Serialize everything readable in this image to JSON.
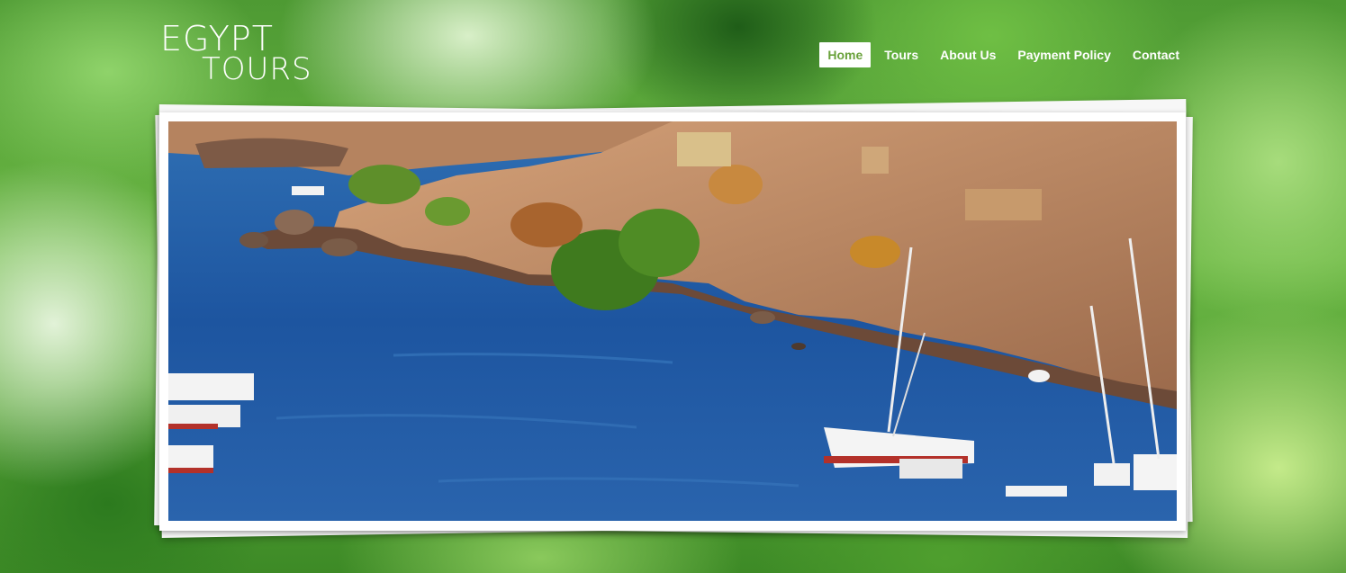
{
  "logo": {
    "line1": "EGYPT",
    "line2": "TOURS"
  },
  "nav": {
    "items": [
      {
        "label": "Home",
        "active": true
      },
      {
        "label": "Tours",
        "active": false
      },
      {
        "label": "About Us",
        "active": false
      },
      {
        "label": "Payment Policy",
        "active": false
      },
      {
        "label": "Contact",
        "active": false
      }
    ]
  },
  "colors": {
    "accent": "#6aa23c",
    "nav_text": "#ffffff",
    "frame": "#ffffff"
  },
  "hero": {
    "image": "nile-river-aswan-feluccas-photo"
  }
}
